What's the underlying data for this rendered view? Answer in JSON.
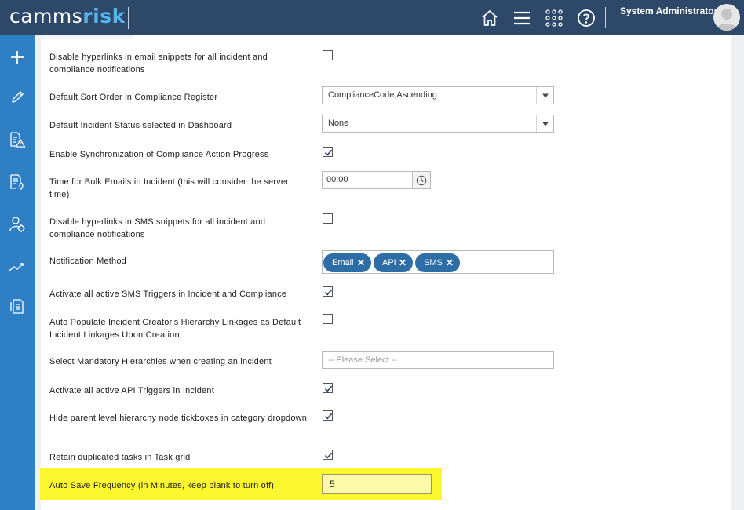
{
  "header": {
    "logo_part1": "camms",
    "logo_part2": "risk",
    "user_name": "System Administrator"
  },
  "icons": {
    "header": [
      "home-icon",
      "menu-icon",
      "apps-grid-icon",
      "help-icon"
    ],
    "sidebar": [
      "add-icon",
      "edit-icon",
      "risk-register-icon",
      "incident-report-icon",
      "hierarchy-user-icon",
      "trend-chart-icon",
      "documents-icon"
    ]
  },
  "colors": {
    "header_bg": "#2d4868",
    "sidebar_bg": "#2e7fc4",
    "logo_accent": "#55b4ea",
    "tag_bg": "#2d6ea7",
    "highlight": "#fbf72e"
  },
  "settings": {
    "disable_email_hyperlinks": {
      "label": "Disable hyperlinks in email snippets for all incident and compliance notifications",
      "checked": false
    },
    "default_sort_order": {
      "label": "Default Sort Order in Compliance Register",
      "value": "ComplianceCode,Ascending"
    },
    "default_incident_status": {
      "label": "Default Incident Status selected in Dashboard",
      "value": "None"
    },
    "enable_sync_progress": {
      "label": "Enable Synchronization of Compliance Action Progress",
      "checked": true
    },
    "bulk_email_time": {
      "label": "Time for Bulk Emails in Incident (this will consider the server time)",
      "value": "00:00"
    },
    "disable_sms_hyperlinks": {
      "label": "Disable hyperlinks in SMS snippets for all incident and compliance notifications",
      "checked": false
    },
    "notification_method": {
      "label": "Notification Method",
      "tags": [
        "Email",
        "API",
        "SMS"
      ],
      "remove_glyph": "✕"
    },
    "activate_sms_triggers": {
      "label": "Activate all active SMS Triggers in Incident and Compliance",
      "checked": true
    },
    "auto_populate_hierarchy": {
      "label": "Auto Populate Incident Creator's Hierarchy Linkages as Default Incident Linkages Upon Creation",
      "checked": false
    },
    "mandatory_hierarchies": {
      "label": "Select Mandatory Hierarchies when creating an incident",
      "placeholder": "-- Please Select --"
    },
    "activate_api_triggers": {
      "label": "Activate all active API Triggers in Incident",
      "checked": true
    },
    "hide_parent_tickboxes": {
      "label": "Hide parent level hierarchy node tickboxes in category dropdown",
      "checked": true
    },
    "retain_duplicated_tasks": {
      "label": "Retain duplicated tasks in Task grid",
      "checked": true
    },
    "auto_save_frequency": {
      "label": "Auto Save Frequency  (in Minutes, keep blank to turn off)",
      "value": "5"
    }
  }
}
